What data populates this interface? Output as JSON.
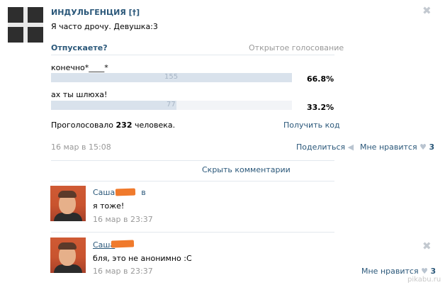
{
  "post": {
    "group_name": "ИНДУЛЬГЕНЦИЯ [†]",
    "text": "Я часто дрочу. Девушка:3",
    "date": "16 мар в 15:08",
    "share_label": "Поделиться",
    "like_label": "Мне нравится",
    "like_count": "3"
  },
  "poll": {
    "question": "Отпускаете?",
    "type": "Открытое голосование",
    "options": [
      {
        "label": "конечно*____*",
        "votes": "155",
        "percent": "66.8%",
        "fraction": 0.668
      },
      {
        "label": "ах ты шлюха!",
        "votes": "77",
        "percent": "33.2%",
        "fraction": 0.332
      }
    ],
    "summary_prefix": "Проголосовало",
    "summary_count": "232",
    "summary_suffix": "человека.",
    "get_code": "Получить код"
  },
  "comments_toggle": "Скрыть комментарии",
  "comments": [
    {
      "author": "Саша Б",
      "author_suffix": "в",
      "text": "я тоже!",
      "date": "16 мар в 23:37"
    },
    {
      "author": "Саша",
      "text": "бля, это не анонимно :С",
      "date": "16 мар в 23:37",
      "like_label": "Мне нравится",
      "like_count": "3"
    }
  ],
  "close_symbol": "✖",
  "watermark": "pikabu.ru",
  "colors": {
    "link": "#2b587a",
    "accent_bar": "#d9e2ec",
    "redaction": "#f07a2c"
  }
}
